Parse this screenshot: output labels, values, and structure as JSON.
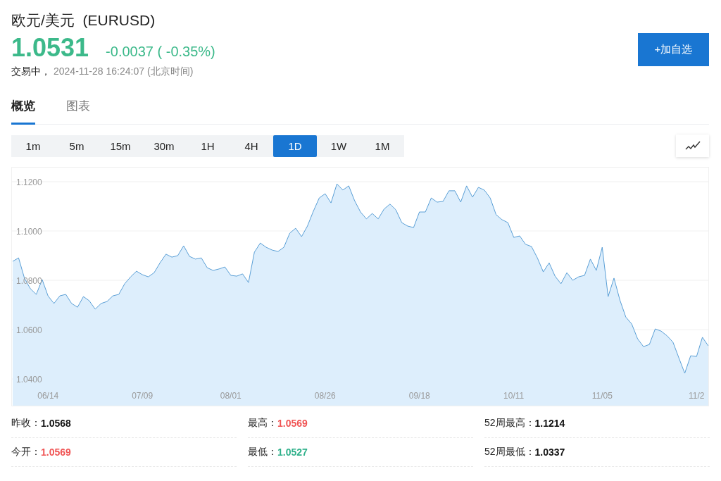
{
  "header": {
    "title": "欧元/美元  (EURUSD)",
    "price": "1.0531",
    "change": "-0.0037 ( -0.35%)",
    "color": "#3cb98a",
    "status": "交易中，",
    "timestamp": "2024-11-28 16:24:07",
    "timezone": "(北京时间)",
    "button": "+加自选"
  },
  "tabs": [
    {
      "label": "概览",
      "selected": true
    },
    {
      "label": "图表",
      "selected": false
    }
  ],
  "periods": [
    {
      "label": "1m",
      "selected": false
    },
    {
      "label": "5m",
      "selected": false
    },
    {
      "label": "15m",
      "selected": false
    },
    {
      "label": "30m",
      "selected": false
    },
    {
      "label": "1H",
      "selected": false
    },
    {
      "label": "4H",
      "selected": false
    },
    {
      "label": "1D",
      "selected": true
    },
    {
      "label": "1W",
      "selected": false
    },
    {
      "label": "1M",
      "selected": false
    }
  ],
  "chart": {
    "chart_data": {
      "type": "area",
      "categories": [
        null,
        null,
        null,
        null,
        null,
        null,
        "06/14",
        null,
        null,
        null,
        null,
        null,
        null,
        null,
        null,
        null,
        null,
        null,
        null,
        null,
        null,
        null,
        "07/09",
        null,
        null,
        null,
        null,
        null,
        null,
        null,
        null,
        null,
        null,
        null,
        null,
        null,
        null,
        "08/01",
        null,
        null,
        null,
        null,
        null,
        null,
        null,
        null,
        null,
        null,
        null,
        null,
        null,
        null,
        null,
        "08/26",
        null,
        null,
        null,
        null,
        null,
        null,
        null,
        null,
        null,
        null,
        null,
        null,
        null,
        null,
        null,
        "09/18",
        null,
        null,
        null,
        null,
        null,
        null,
        null,
        null,
        null,
        null,
        null,
        null,
        null,
        null,
        null,
        "10/11",
        null,
        null,
        null,
        null,
        null,
        null,
        null,
        null,
        null,
        null,
        null,
        null,
        null,
        null,
        "11/05",
        null,
        null,
        null,
        null,
        null,
        null,
        null,
        null,
        null,
        null,
        null,
        null,
        null,
        null,
        null,
        "11/2",
        null,
        null
      ],
      "series": [
        {
          "color": "#5a9fd6",
          "values": [
            1.0877,
            1.0891,
            1.0809,
            1.0766,
            1.0743,
            1.0803,
            1.0737,
            1.0706,
            1.0737,
            1.0743,
            1.0706,
            1.0691,
            1.0734,
            1.0717,
            1.0683,
            1.0706,
            1.0714,
            1.0737,
            1.0743,
            1.0786,
            1.0814,
            1.0837,
            1.0823,
            1.0814,
            1.0831,
            1.0871,
            1.0906,
            1.0894,
            1.09,
            1.094,
            1.0897,
            1.0886,
            1.0891,
            1.0851,
            1.084,
            1.0846,
            1.0854,
            1.082,
            1.0817,
            1.0826,
            1.0791,
            1.0914,
            1.0951,
            1.0934,
            1.0923,
            1.0917,
            1.0934,
            1.0991,
            1.1011,
            1.0977,
            1.102,
            1.108,
            1.1134,
            1.1151,
            1.1114,
            1.1191,
            1.1166,
            1.1183,
            1.1123,
            1.1077,
            1.1049,
            1.1071,
            1.1049,
            1.1089,
            1.1109,
            1.1086,
            1.1034,
            1.102,
            1.1014,
            1.1077,
            1.1077,
            1.1134,
            1.1117,
            1.112,
            1.1163,
            1.1163,
            1.1117,
            1.1183,
            1.1137,
            1.1177,
            1.1166,
            1.1134,
            1.1066,
            1.1046,
            1.1034,
            1.0974,
            1.098,
            1.0946,
            1.0937,
            1.0891,
            1.0834,
            1.0871,
            1.0817,
            1.0786,
            1.0831,
            1.08,
            1.0814,
            1.082,
            1.0886,
            1.084,
            1.0934,
            1.0734,
            1.0809,
            1.072,
            1.0651,
            1.0623,
            1.0563,
            1.0531,
            1.054,
            1.0603,
            1.0594,
            1.0575,
            1.0549,
            1.0486,
            1.0423,
            1.0494,
            1.0491,
            1.0569,
            1.0534
          ]
        }
      ],
      "ylim": [
        1.0286,
        1.1257
      ],
      "grid": true,
      "yticks": [
        {
          "value": 1.04,
          "label": "1.0400"
        },
        {
          "value": 1.06,
          "label": "1.0600"
        },
        {
          "value": 1.08,
          "label": "1.0800"
        },
        {
          "value": 1.1,
          "label": "1.1000"
        },
        {
          "value": 1.12,
          "label": "1.1200"
        }
      ]
    }
  },
  "stats": [
    {
      "label": "昨收：",
      "value": "1.0568",
      "color": "#111111"
    },
    {
      "label": "最高：",
      "value": "1.0569",
      "color": "#f05454"
    },
    {
      "label": "52周最高：",
      "value": "1.1214",
      "color": "#111111"
    },
    {
      "label": "今开：",
      "value": "1.0569",
      "color": "#f05454"
    },
    {
      "label": "最低：",
      "value": "1.0527",
      "color": "#2eb08a"
    },
    {
      "label": "52周最低：",
      "value": "1.0337",
      "color": "#111111"
    }
  ]
}
